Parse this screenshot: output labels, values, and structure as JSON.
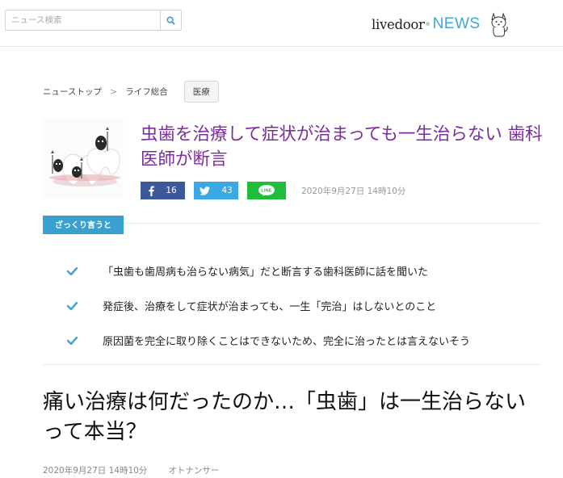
{
  "header": {
    "search_placeholder": "ニュース検索",
    "logo_livedoor": "livedoor",
    "logo_reg": "®",
    "logo_news": "NEWS"
  },
  "breadcrumb": {
    "items": [
      "ニューストップ",
      "ライフ総合"
    ],
    "separator": ">",
    "tag": "医療"
  },
  "article": {
    "title": "虫歯を治療して症状が治まっても一生治らない 歯科医師が断言",
    "share": {
      "facebook_count": "16",
      "twitter_count": "43",
      "line_label": "LINE"
    },
    "date": "2020年9月27日 14時10分"
  },
  "summary": {
    "label": "ざっくり言うと",
    "points": [
      "「虫歯も歯周病も治らない病気」だと断言する歯科医師に話を聞いた",
      "発症後、治療をして症状が治まっても、一生「完治」はしないとのこと",
      "原因菌を完全に取り除くことはできないため、完全に治ったとは言えないそう"
    ]
  },
  "body": {
    "heading": "痛い治療は何だったのか…「虫歯」は一生治らないって本当？",
    "date": "2020年9月27日 14時10分",
    "source": "オトナンサー"
  },
  "colors": {
    "title": "#7b2d9d",
    "accent": "#3aa0cf",
    "facebook": "#3b5998",
    "twitter": "#3aa8e4",
    "line": "#1fbd3a",
    "news_logo": "#3fa6dc"
  }
}
